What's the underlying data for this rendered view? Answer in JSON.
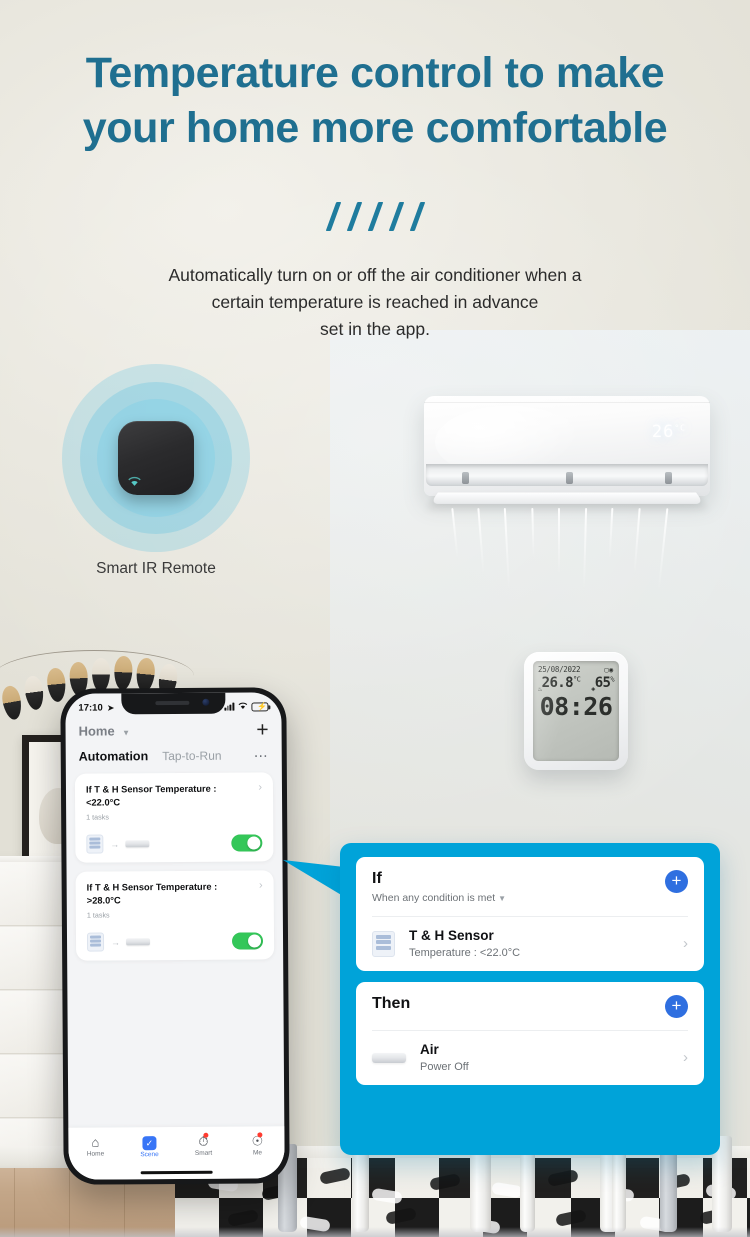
{
  "headline": {
    "line1": "Temperature control to make",
    "line2": "your home more comfortable",
    "color": "#1f6f90",
    "slash_count": 5
  },
  "subtitle": {
    "line1": "Automatically turn on or off the air conditioner when a",
    "line2": "certain temperature is reached in advance",
    "line3": "set in the app."
  },
  "ir_remote": {
    "label": "Smart IR Remote",
    "wifi_icon": "wifi-icon"
  },
  "air_conditioner": {
    "display_value": "26",
    "display_unit": "°C"
  },
  "sensor": {
    "date": "25/08/2022",
    "battery_icon": "battery-icon",
    "wifi_icon": "wifi-icon",
    "temperature": "26.8",
    "temperature_unit": "°C",
    "humidity": "65",
    "humidity_unit": "%",
    "time": "08:26"
  },
  "phone": {
    "status": {
      "time": "17:10",
      "location_icon": "location-arrow-icon",
      "signal_icon": "signal-bars-icon",
      "wifi_icon": "wifi-icon",
      "battery_icon": "battery-charging-icon",
      "battery_color": "#32c759"
    },
    "header": {
      "home_label": "Home",
      "caret_icon": "chevron-down-icon",
      "add_icon": "plus-icon"
    },
    "tabs": [
      {
        "label": "Automation",
        "active": true
      },
      {
        "label": "Tap-to-Run",
        "active": false
      }
    ],
    "more_icon": "ellipsis-icon",
    "automations": [
      {
        "title": "If T & H Sensor Temperature : <22.0°C",
        "tasks": "1 tasks",
        "chevron_icon": "chevron-right-icon",
        "from_icon": "temp-humidity-sensor-icon",
        "arrow_icon": "arrow-right-icon",
        "to_icon": "air-conditioner-icon",
        "enabled": true
      },
      {
        "title": "If T & H Sensor Temperature : >28.0°C",
        "tasks": "1 tasks",
        "chevron_icon": "chevron-right-icon",
        "from_icon": "temp-humidity-sensor-icon",
        "arrow_icon": "arrow-right-icon",
        "to_icon": "air-conditioner-icon",
        "enabled": true
      }
    ],
    "tabbar": [
      {
        "label": "Home",
        "icon": "home-icon",
        "active": false,
        "badge": false
      },
      {
        "label": "Scene",
        "icon": "scene-check-icon",
        "active": true,
        "badge": false
      },
      {
        "label": "Smart",
        "icon": "smart-clock-icon",
        "active": false,
        "badge": true
      },
      {
        "label": "Me",
        "icon": "profile-icon",
        "active": false,
        "badge": true
      }
    ],
    "accent_color": "#3875f6"
  },
  "callout": {
    "background_color": "#00a3d9",
    "if_card": {
      "title": "If",
      "subtitle": "When any condition is met",
      "subtitle_caret_icon": "chevron-down-icon",
      "add_icon": "plus-icon",
      "device_icon": "temp-humidity-sensor-icon",
      "device_name": "T & H Sensor",
      "device_desc": "Temperature : <22.0°C",
      "chevron_icon": "chevron-right-icon"
    },
    "then_card": {
      "title": "Then",
      "add_icon": "plus-icon",
      "device_icon": "air-conditioner-icon",
      "device_name": "Air",
      "device_desc": "Power Off",
      "chevron_icon": "chevron-right-icon"
    }
  }
}
